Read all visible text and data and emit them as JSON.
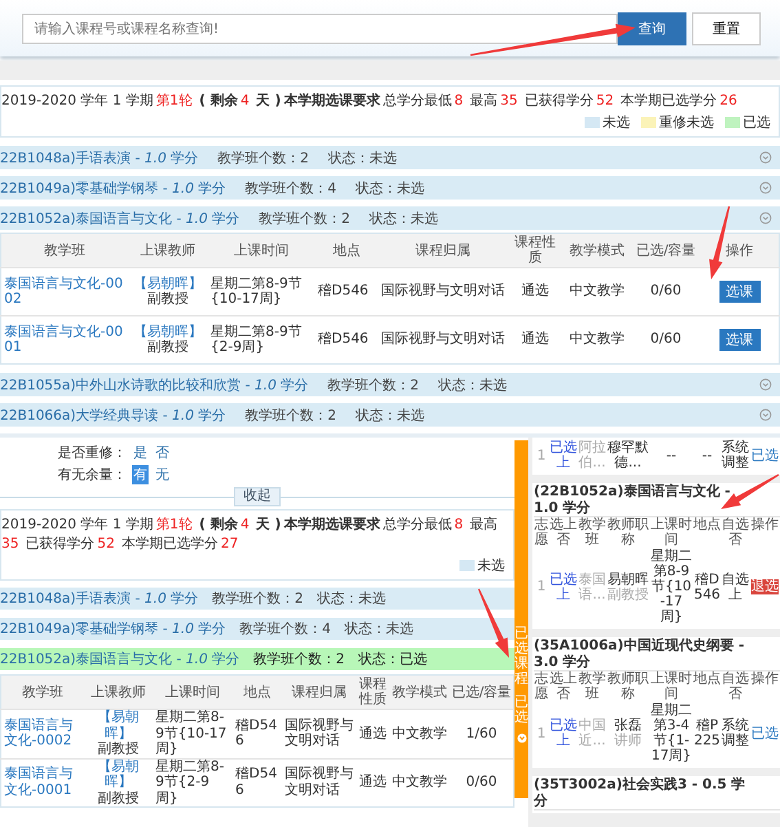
{
  "search": {
    "placeholder": "请输入课程号或课程名称查询!",
    "buttons": [
      {
        "label": "查询",
        "kind": "primary"
      },
      {
        "label": "重置",
        "kind": "default"
      }
    ]
  },
  "top_panel": {
    "info": [
      {
        "text": "2019-2020 学年 1 学期",
        "kind": "plain"
      },
      {
        "text": "第1轮",
        "kind": "red"
      },
      {
        "text": "( 剩余 ",
        "kind": "bold"
      },
      {
        "text": "4",
        "kind": "red"
      },
      {
        "text": " 天 )",
        "kind": "bold"
      },
      {
        "text": "本学期选课要求",
        "kind": "bold"
      },
      {
        "text": "总学分最低",
        "kind": "plain"
      },
      {
        "text": "8",
        "kind": "red"
      },
      {
        "text": "最高",
        "kind": "plain"
      },
      {
        "text": "35",
        "kind": "red"
      },
      {
        "text": "已获得学分",
        "kind": "plain"
      },
      {
        "text": "52",
        "kind": "red"
      },
      {
        "text": "本学期已选学分",
        "kind": "plain"
      },
      {
        "text": "26",
        "kind": "red"
      }
    ],
    "legend": [
      {
        "label": "未选",
        "color": "#d5e8f4"
      },
      {
        "label": "重修未选",
        "color": "#fbf3b8"
      },
      {
        "label": "已选",
        "color": "#bff3bf"
      }
    ],
    "courses": [
      {
        "title": "22B1048a)手语表演 - *1.0* 学分",
        "count": "教学班个数：2",
        "status": "状态：未选",
        "selected": false
      },
      {
        "title": "22B1049a)零基础学钢琴 - *1.0* 学分",
        "count": "教学班个数：4",
        "status": "状态：未选",
        "selected": false
      },
      {
        "title": "22B1052a)泰国语言与文化 - *1.0* 学分",
        "count": "教学班个数：2",
        "status": "状态：未选",
        "selected": false,
        "columns": [
          "教学班",
          "上课教师",
          "上课时间",
          "地点",
          "课程归属",
          "课程性质",
          "教学模式",
          "已选/容量",
          "操作"
        ],
        "classes": [
          {
            "name": "泰国语言与文化-0002",
            "teacher": "【易朝晖】",
            "title": "副教授",
            "time": "星期二第8-9节{10-17周}",
            "place": "稽D546",
            "belong": "国际视野与文明对话",
            "nature": "通选",
            "mode": "中文教学",
            "count": "0/60",
            "action": "选课"
          },
          {
            "name": "泰国语言与文化-0001",
            "teacher": "【易朝晖】",
            "title": "副教授",
            "time": "星期二第8-9节{2-9周}",
            "place": "稽D546",
            "belong": "国际视野与文明对话",
            "nature": "通选",
            "mode": "中文教学",
            "count": "0/60",
            "action": "选课"
          }
        ]
      },
      {
        "title": "22B1055a)中外山水诗歌的比较和欣赏 - *1.0* 学分",
        "count": "教学班个数：2",
        "status": "状态：未选",
        "selected": false
      },
      {
        "title": "22B1066a)大学经典导读 - *1.0* 学分",
        "count": "教学班个数：2",
        "status": "状态：未选",
        "selected": false
      }
    ]
  },
  "bottom_panel": {
    "filters": [
      {
        "label": "是否重修：",
        "options": [
          {
            "label": "是",
            "selected": false
          },
          {
            "label": "否",
            "selected": false
          }
        ]
      },
      {
        "label": "有无余量：",
        "options": [
          {
            "label": "有",
            "selected": true
          },
          {
            "label": "无",
            "selected": false
          }
        ]
      }
    ],
    "collapse": "收起",
    "info": [
      {
        "text": "2019-2020 学年 1 学期",
        "kind": "plain"
      },
      {
        "text": "第1轮",
        "kind": "red"
      },
      {
        "text": "( 剩余 ",
        "kind": "bold"
      },
      {
        "text": "4",
        "kind": "red"
      },
      {
        "text": " 天 )",
        "kind": "bold"
      },
      {
        "text": "本学期选课要求",
        "kind": "bold"
      },
      {
        "text": "总学分最低",
        "kind": "plain"
      },
      {
        "text": "8",
        "kind": "red"
      },
      {
        "text": "最高",
        "kind": "plain"
      },
      {
        "text": "35",
        "kind": "red"
      },
      {
        "text": "已获得学分",
        "kind": "plain"
      },
      {
        "text": "52",
        "kind": "red"
      },
      {
        "text": "本学期已选学分",
        "kind": "plain"
      },
      {
        "text": "27",
        "kind": "red"
      }
    ],
    "legend": [
      {
        "label": "未选",
        "color": "#d5e8f4"
      }
    ],
    "courses": [
      {
        "title": "22B1048a)手语表演 - *1.0* 学分",
        "count": "教学班个数：2",
        "status": "状态：未选",
        "selected": false
      },
      {
        "title": "22B1049a)零基础学钢琴 - *1.0* 学分",
        "count": "教学班个数：4",
        "status": "状态：未选",
        "selected": false
      },
      {
        "title": "22B1052a)泰国语言与文化 - *1.0* 学分",
        "count": "教学班个数：2",
        "status": "状态：已选",
        "selected": true,
        "columns": [
          "教学班",
          "上课教师",
          "上课时间",
          "地点",
          "课程归属",
          "课程性质",
          "教学模式",
          "已选/容量"
        ],
        "classes": [
          {
            "name": "泰国语言与文化-0002",
            "teacher": "【易朝晖】",
            "title": "副教授",
            "time": "星期二第8-9节{10-17周}",
            "place": "稽D546",
            "belong": "国际视野与文明对话",
            "nature": "通选",
            "mode": "中文教学",
            "count": "1/60"
          },
          {
            "name": "泰国语言与文化-0001",
            "teacher": "【易朝晖】",
            "title": "副教授",
            "time": "星期二第8-9节{2-9周}",
            "place": "稽D546",
            "belong": "国际视野与文明对话",
            "nature": "通选",
            "mode": "中文教学",
            "count": "0/60"
          }
        ]
      }
    ]
  },
  "side_tab": {
    "label": "已选课程",
    "badge": "已选"
  },
  "selected_panel": {
    "cards": [
      {
        "row": {
          "volunteer": "1",
          "chosen": "已选上",
          "class": "阿拉伯...",
          "teacher": "穆罕默德...",
          "time": "--",
          "place": "--",
          "self": "系统调整",
          "action": {
            "text": "已选",
            "kind": "link"
          }
        }
      },
      {
        "title": "(22B1052a)泰国语言与文化 - 1.0 学分",
        "columns": [
          "志愿",
          "选上否",
          "教学班",
          "教师职称",
          "上课时间",
          "地点",
          "自选否",
          "操作"
        ],
        "row": {
          "volunteer": "1",
          "chosen": "已选上",
          "class": "泰国语...",
          "teacher": "易朝晖",
          "teacher_title": "副教授",
          "time": "星期二第8-9节{10-17周}",
          "place": "稽D546",
          "self": "自选上",
          "action": {
            "text": "退选",
            "kind": "button"
          }
        }
      },
      {
        "title": "(35A1006a)中国近现代史纲要 - 3.0 学分",
        "columns": [
          "志愿",
          "选上否",
          "教学班",
          "教师职称",
          "上课时间",
          "地点",
          "自选否",
          "操作"
        ],
        "row": {
          "volunteer": "1",
          "chosen": "已选上",
          "class": "中国近...",
          "teacher": "张磊",
          "teacher_title": "讲师",
          "time": "星期二第3-4节{1-17周}",
          "place": "稽P225",
          "self": "系统调整",
          "action": {
            "text": "已选",
            "kind": "link"
          }
        }
      },
      {
        "title": "(35T3002a)社会实践3 - 0.5 学分"
      }
    ]
  }
}
